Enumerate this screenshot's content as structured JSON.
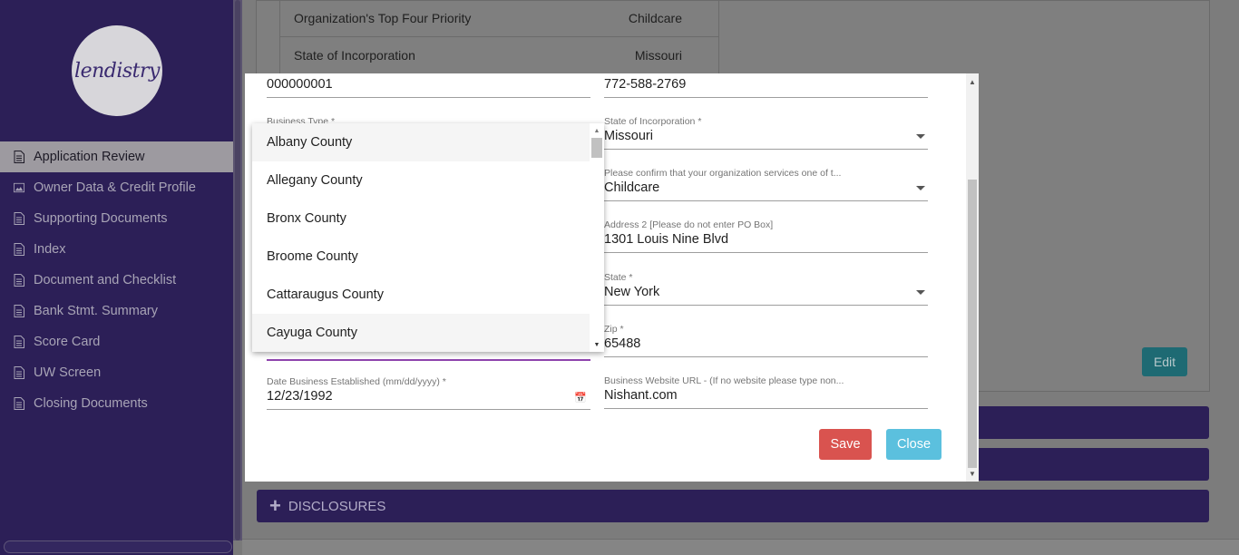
{
  "sidebar": {
    "logo_text": "lendistry",
    "items": [
      {
        "label": "Application Review",
        "icon": "document-icon"
      },
      {
        "label": "Owner Data & Credit Profile",
        "icon": "image-icon"
      },
      {
        "label": "Supporting Documents",
        "icon": "document-icon"
      },
      {
        "label": "Index",
        "icon": "document-icon"
      },
      {
        "label": "Document and Checklist",
        "icon": "document-icon"
      },
      {
        "label": "Bank Stmt. Summary",
        "icon": "document-icon"
      },
      {
        "label": "Score Card",
        "icon": "document-icon"
      },
      {
        "label": "UW Screen",
        "icon": "document-icon"
      },
      {
        "label": "Closing Documents",
        "icon": "document-icon"
      }
    ]
  },
  "background": {
    "table": [
      {
        "label": "Organization's Top Four Priority",
        "value": "Childcare"
      },
      {
        "label": "State of Incorporation",
        "value": "Missouri"
      }
    ],
    "edit_label": "Edit",
    "disclosures_label": "DISCLOSURES"
  },
  "modal": {
    "left": {
      "top_value": "000000001",
      "business_type_label": "Business Type *",
      "date_label": "Date Business Established (mm/dd/yyyy) *",
      "date_value": "12/23/1992"
    },
    "right": {
      "phone_value": "772-588-2769",
      "state_inc_label": "State of Incorporation *",
      "state_inc_value": "Missouri",
      "confirm_label": "Please confirm that your organization services one of t...",
      "confirm_value": "Childcare",
      "address2_label": "Address 2 [Please do not enter PO Box]",
      "address2_value": "1301 Louis Nine Blvd",
      "state_label": "State *",
      "state_value": "New York",
      "zip_label": "Zip *",
      "zip_value": "65488",
      "website_label": "Business Website URL - (If no website please type non...",
      "website_value": "Nishant.com"
    },
    "save_label": "Save",
    "close_label": "Close"
  },
  "dropdown": {
    "options": [
      "Albany County",
      "Allegany County",
      "Bronx County",
      "Broome County",
      "Cattaraugus County",
      "Cayuga County"
    ],
    "highlighted": [
      "Albany County",
      "Cayuga County"
    ]
  },
  "colors": {
    "sidebar": "#2c1f57",
    "save": "#d9534f",
    "close": "#5bc0de",
    "focus_underline": "#8e44ad"
  }
}
